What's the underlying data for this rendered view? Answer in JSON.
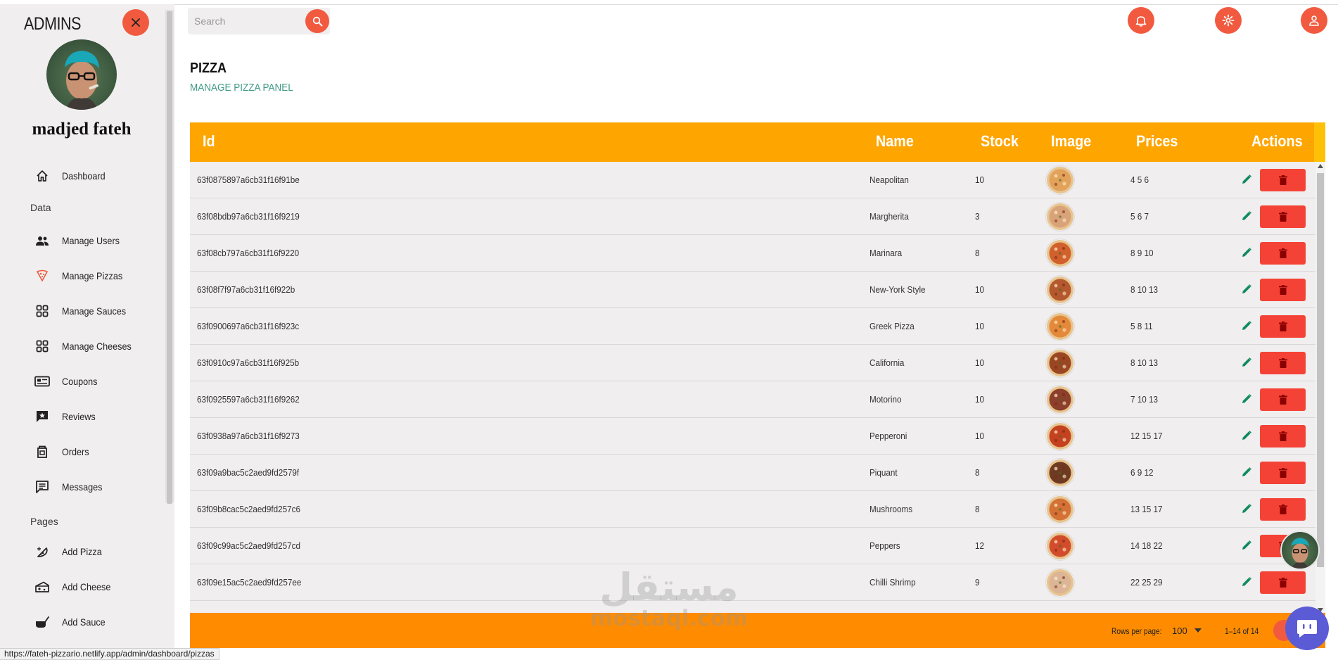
{
  "sidebar": {
    "title": "ADMINS",
    "user_name": "madjed fateh",
    "sections": {
      "data": "Data",
      "pages": "Pages"
    },
    "items": [
      {
        "label": "Dashboard",
        "icon": "home-icon"
      },
      {
        "label": "Manage Users",
        "icon": "users-icon"
      },
      {
        "label": "Manage Pizzas",
        "icon": "pizza-icon"
      },
      {
        "label": "Manage Sauces",
        "icon": "grid-icon"
      },
      {
        "label": "Manage Cheeses",
        "icon": "grid-icon"
      },
      {
        "label": "Coupons",
        "icon": "coupon-icon"
      },
      {
        "label": "Reviews",
        "icon": "review-icon"
      },
      {
        "label": "Orders",
        "icon": "orders-icon"
      },
      {
        "label": "Messages",
        "icon": "message-icon"
      },
      {
        "label": "Add Pizza",
        "icon": "add-pizza-icon"
      },
      {
        "label": "Add Cheese",
        "icon": "cheese-icon"
      },
      {
        "label": "Add Sauce",
        "icon": "sauce-icon"
      }
    ]
  },
  "topbar": {
    "search_placeholder": "Search"
  },
  "header": {
    "title": "PIZZA",
    "subtitle": "MANAGE PIZZA PANEL"
  },
  "table": {
    "columns": [
      "Id",
      "Name",
      "Stock",
      "Image",
      "Prices",
      "Actions"
    ],
    "rows": [
      {
        "id": "63f0875897a6cb31f16f91be",
        "name": "Neapolitan",
        "stock": "10",
        "prices": "4  5  6",
        "color": "#e2a25a"
      },
      {
        "id": "63f08bdb97a6cb31f16f9219",
        "name": "Margherita",
        "stock": "3",
        "prices": "5  6  7",
        "color": "#d9a37a"
      },
      {
        "id": "63f08cb797a6cb31f16f9220",
        "name": "Marinara",
        "stock": "8",
        "prices": "8  9  10",
        "color": "#d1602d"
      },
      {
        "id": "63f08f7f97a6cb31f16f922b",
        "name": "New-York Style",
        "stock": "10",
        "prices": "8  10  13",
        "color": "#b4592f"
      },
      {
        "id": "63f0900697a6cb31f16f923c",
        "name": "Greek Pizza",
        "stock": "10",
        "prices": "5  8  11",
        "color": "#e4883a"
      },
      {
        "id": "63f0910c97a6cb31f16f925b",
        "name": "California",
        "stock": "10",
        "prices": "8  10  13",
        "color": "#9b4622"
      },
      {
        "id": "63f0925597a6cb31f16f9262",
        "name": "Motorino",
        "stock": "10",
        "prices": "7  10  13",
        "color": "#8c3f2a"
      },
      {
        "id": "63f0938a97a6cb31f16f9273",
        "name": "Pepperoni",
        "stock": "10",
        "prices": "12  15  17",
        "color": "#c4421f"
      },
      {
        "id": "63f09a9bac5c2aed9fd2579f",
        "name": "Piquant",
        "stock": "8",
        "prices": "6  9  12",
        "color": "#6e3a22"
      },
      {
        "id": "63f09b8cac5c2aed9fd257c6",
        "name": "Mushrooms",
        "stock": "8",
        "prices": "13  15  17",
        "color": "#d47236"
      },
      {
        "id": "63f09c99ac5c2aed9fd257cd",
        "name": "Peppers",
        "stock": "12",
        "prices": "14  18  22",
        "color": "#d24c2c"
      },
      {
        "id": "63f09e15ac5c2aed9fd257ee",
        "name": "Chilli Shrimp",
        "stock": "9",
        "prices": "22  25  29",
        "color": "#dcb596"
      }
    ]
  },
  "footer": {
    "rows_per_page_label": "Rows per page:",
    "rows_per_page_value": "100",
    "range": "1–14 of 14"
  },
  "watermark": {
    "arabic": "مستقل",
    "latin": "mostaql.com"
  },
  "status_url": "https://fateh-pizzario.netlify.app/admin/dashboard/pizzas",
  "colors": {
    "accent": "#f15a3f",
    "header": "#ffa500",
    "footer": "#ff8c00",
    "subtitle": "#3f9a84",
    "delete": "#f44336",
    "edit": "#0f8a5f"
  }
}
